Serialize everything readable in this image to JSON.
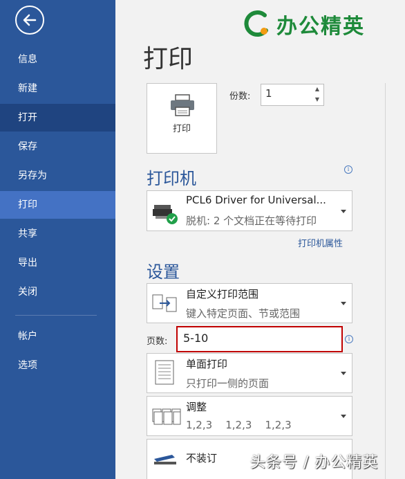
{
  "logo": {
    "text": "办公精英"
  },
  "sidebar": {
    "items": [
      {
        "label": "信息"
      },
      {
        "label": "新建"
      },
      {
        "label": "打开"
      },
      {
        "label": "保存"
      },
      {
        "label": "另存为"
      },
      {
        "label": "打印"
      },
      {
        "label": "共享"
      },
      {
        "label": "导出"
      },
      {
        "label": "关闭"
      },
      {
        "label": "帐户"
      },
      {
        "label": "选项"
      }
    ],
    "active_item": "打印"
  },
  "main": {
    "title": "打印",
    "print_button": {
      "label": "打印"
    },
    "copies": {
      "label": "份数:",
      "value": "1"
    },
    "printer": {
      "heading": "打印机",
      "name": "PCL6 Driver for Universal...",
      "status": "脱机: 2 个文档正在等待打印",
      "properties_link": "打印机属性"
    },
    "settings": {
      "heading": "设置",
      "range": {
        "title": "自定义打印范围",
        "subtitle": "键入特定页面、节或范围"
      },
      "pages": {
        "label": "页数:",
        "value": "5-10"
      },
      "sides": {
        "title": "单面打印",
        "subtitle": "只打印一侧的页面"
      },
      "collate": {
        "title": "调整",
        "subtitle": "1,2,3    1,2,3    1,2,3"
      },
      "staple": {
        "title": "不装订"
      }
    }
  },
  "watermark": {
    "text": "头条号 / 办公精英"
  },
  "colors": {
    "sidebar": "#2b579a",
    "accent": "#2b579a",
    "highlight_border": "#c00000"
  }
}
